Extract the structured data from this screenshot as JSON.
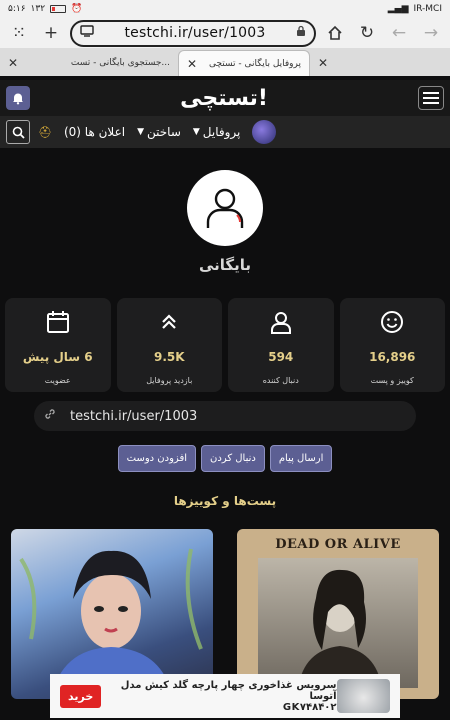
{
  "status": {
    "time": "۵:۱۶",
    "extra": "۱۳۲",
    "battery": "۵",
    "carrier": "IR-MCI"
  },
  "browser": {
    "url": "testchi.ir/user/1003"
  },
  "tabs": [
    {
      "title": "جستجوی بایگانی - تست..."
    },
    {
      "title": "پروفایل بایگانی - تستچی"
    }
  ],
  "header": {
    "logo": "تستچی!"
  },
  "nav": {
    "profile": "پروفایل",
    "build": "ساختن",
    "notifications": "اعلان ها (0)"
  },
  "profile": {
    "name": "بایگانی"
  },
  "stats": [
    {
      "value": "16,896",
      "label": "کوییز و پست",
      "icon": "smile-icon"
    },
    {
      "value": "594",
      "label": "دنبال کننده",
      "icon": "user-icon"
    },
    {
      "value": "9.5K",
      "label": "بازدید پروفایل",
      "icon": "chevrons-up-icon"
    },
    {
      "value": "6 سال پیش",
      "label": "عضویت",
      "icon": "calendar-icon"
    }
  ],
  "link": {
    "text": "testchi.ir/user/1003"
  },
  "actions": {
    "message": "ارسال پیام",
    "follow": "دنبال کردن",
    "add_friend": "افزودن دوست"
  },
  "section": {
    "title": "پست‌ها و کوییزها"
  },
  "posts": [
    {
      "banner": ""
    },
    {
      "banner": "DEAD OR ALIVE"
    }
  ],
  "ad": {
    "line1": "سرویس غذاخوری چهار پارچه گلد کیش مدل آتوسا",
    "line2": "GK۷۴۸۴۰۲",
    "buy": "خرید"
  },
  "colors": {
    "accent": "#5c5f93",
    "gold": "#e4cf8a",
    "bg": "#0e0e0f",
    "card": "#1e1e1f",
    "ad_button": "#e02424"
  }
}
